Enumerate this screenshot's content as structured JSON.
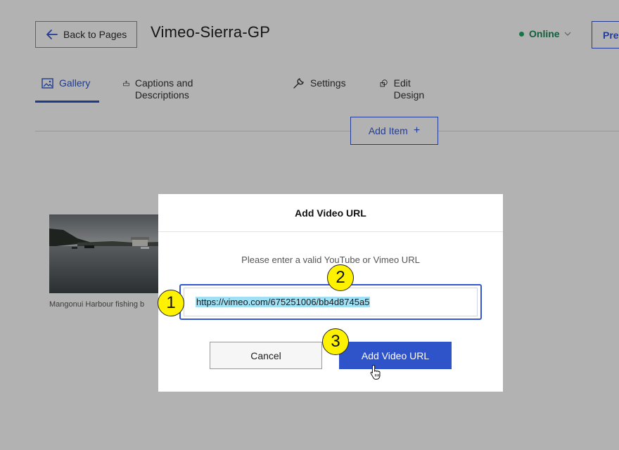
{
  "header": {
    "back_label": "Back to Pages",
    "title": "Vimeo-Sierra-GP",
    "status": "Online",
    "preview_label": "Pre"
  },
  "tabs": [
    {
      "label": "Gallery",
      "icon": "image-icon",
      "active": true
    },
    {
      "label": "Captions and Descriptions",
      "icon": "captions-icon",
      "active": false
    },
    {
      "label": "Settings",
      "icon": "wrench-icon",
      "active": false
    },
    {
      "label": "Edit Design",
      "icon": "design-icon",
      "active": false
    }
  ],
  "toolbar": {
    "add_item_label": "Add Item",
    "add_item_icon": "+"
  },
  "gallery": {
    "items": [
      {
        "caption": "Mangonui Harbour fishing b"
      }
    ]
  },
  "modal": {
    "title": "Add Video URL",
    "prompt": "Please enter a valid YouTube or Vimeo URL",
    "url_value": "https://vimeo.com/675251006/bb4d8745a5",
    "cancel_label": "Cancel",
    "submit_label": "Add Video URL"
  },
  "markers": [
    "1",
    "2",
    "3"
  ],
  "colors": {
    "accent": "#2f54c9",
    "online": "#1b8a57",
    "marker": "#fff200",
    "selection": "#9fe0f4"
  }
}
